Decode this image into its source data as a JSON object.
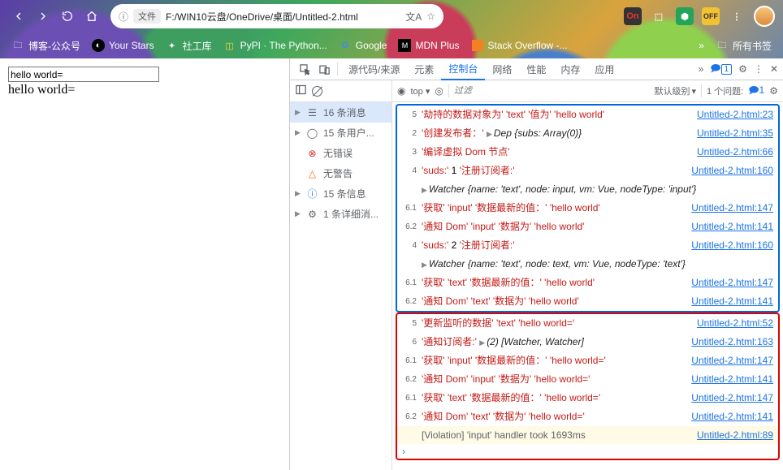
{
  "url": {
    "scheme_label": "文件",
    "path": "F:/WIN10云盘/OneDrive/桌面/Untitled-2.html"
  },
  "bookmarks": {
    "items": [
      "博客-公众号",
      "Your Stars",
      "社工库",
      "PyPI · The Python...",
      "Google",
      "MDN Plus",
      "Stack Overflow -..."
    ],
    "all": "所有书签"
  },
  "page": {
    "input_value": "hello world=",
    "text": "hello world="
  },
  "devtools": {
    "tabs": [
      "源代码/来源",
      "元素",
      "控制台",
      "网络",
      "性能",
      "内存",
      "应用"
    ],
    "active_tab": 2,
    "right_badge": "1",
    "filter_top": "top",
    "filter_placeholder": "过滤",
    "level_label": "默认级别",
    "issues_label": "1 个问题:",
    "issues_count": "1",
    "sidebar": {
      "header_count": "16 条消息",
      "items": [
        {
          "icon": "user",
          "label": "15 条用户..."
        },
        {
          "icon": "error",
          "label": "无错误"
        },
        {
          "icon": "warn",
          "label": "无警告"
        },
        {
          "icon": "info",
          "label": "15 条信息"
        },
        {
          "icon": "verbose",
          "label": "1 条详细消..."
        }
      ]
    },
    "console_groups": [
      {
        "border": "blue",
        "rows": [
          {
            "n": "5",
            "type": "msg",
            "parts": [
              [
                "str",
                "'劫持的数据对象为'"
              ],
              [
                "txt",
                " "
              ],
              [
                "str",
                "'text'"
              ],
              [
                "txt",
                " "
              ],
              [
                "str",
                "'值为'"
              ],
              [
                "txt",
                " "
              ],
              [
                "str",
                "'hello world'"
              ]
            ],
            "link": "Untitled-2.html:23"
          },
          {
            "n": "2",
            "type": "obj",
            "parts": [
              [
                "str",
                "'创建发布者：'"
              ],
              [
                "txt",
                "  "
              ],
              [
                "tri",
                ""
              ],
              [
                "obj",
                "Dep"
              ],
              [
                "txt",
                "  "
              ],
              [
                "obj",
                "{subs: Array(0)}"
              ]
            ],
            "link": "Untitled-2.html:35"
          },
          {
            "n": "3",
            "type": "msg",
            "parts": [
              [
                "str",
                "'编译虚拟 Dom 节点'"
              ]
            ],
            "link": "Untitled-2.html:66"
          },
          {
            "n": "4",
            "type": "msg",
            "parts": [
              [
                "str",
                "'suds:'"
              ],
              [
                "txt",
                " 1 "
              ],
              [
                "str",
                "'注册订阅者:'"
              ]
            ],
            "link": "Untitled-2.html:160"
          },
          {
            "n": "",
            "type": "obj",
            "parts": [
              [
                "tri",
                ""
              ],
              [
                "obj",
                "Watcher  {name: 'text', node: input, vm: Vue, nodeType: 'input'}"
              ]
            ],
            "link": ""
          },
          {
            "n": "6.1",
            "type": "msg",
            "parts": [
              [
                "str",
                "'获取'"
              ],
              [
                "txt",
                " "
              ],
              [
                "str",
                "'input'"
              ],
              [
                "txt",
                " "
              ],
              [
                "str",
                "'数据最新的值：'"
              ],
              [
                "txt",
                " "
              ],
              [
                "str",
                "'hello world'"
              ]
            ],
            "link": "Untitled-2.html:147"
          },
          {
            "n": "6.2",
            "type": "msg",
            "parts": [
              [
                "str",
                "'通知 Dom'"
              ],
              [
                "txt",
                " "
              ],
              [
                "str",
                "'input'"
              ],
              [
                "txt",
                " "
              ],
              [
                "str",
                "'数据为'"
              ],
              [
                "txt",
                " "
              ],
              [
                "str",
                "'hello world'"
              ]
            ],
            "link": "Untitled-2.html:141"
          },
          {
            "n": "4",
            "type": "msg",
            "parts": [
              [
                "str",
                "'suds:'"
              ],
              [
                "txt",
                " 2 "
              ],
              [
                "str",
                "'注册订阅者:'"
              ]
            ],
            "link": "Untitled-2.html:160"
          },
          {
            "n": "",
            "type": "obj",
            "parts": [
              [
                "tri",
                ""
              ],
              [
                "obj",
                "Watcher  {name: 'text', node: text, vm: Vue, nodeType: 'text'}"
              ]
            ],
            "link": ""
          },
          {
            "n": "6.1",
            "type": "msg",
            "parts": [
              [
                "str",
                "'获取'"
              ],
              [
                "txt",
                " "
              ],
              [
                "str",
                "'text'"
              ],
              [
                "txt",
                " "
              ],
              [
                "str",
                "'数据最新的值：'"
              ],
              [
                "txt",
                " "
              ],
              [
                "str",
                "'hello world'"
              ]
            ],
            "link": "Untitled-2.html:147"
          },
          {
            "n": "6.2",
            "type": "msg",
            "parts": [
              [
                "str",
                "'通知 Dom'"
              ],
              [
                "txt",
                " "
              ],
              [
                "str",
                "'text'"
              ],
              [
                "txt",
                " "
              ],
              [
                "str",
                "'数据为'"
              ],
              [
                "txt",
                " "
              ],
              [
                "str",
                "'hello world'"
              ]
            ],
            "link": "Untitled-2.html:141"
          }
        ]
      },
      {
        "border": "red",
        "rows": [
          {
            "n": "5",
            "type": "msg",
            "parts": [
              [
                "str",
                "'更新监听的数据'"
              ],
              [
                "txt",
                " "
              ],
              [
                "str",
                "'text'"
              ],
              [
                "txt",
                " "
              ],
              [
                "str",
                "'hello world='"
              ]
            ],
            "link": "Untitled-2.html:52"
          },
          {
            "n": "6",
            "type": "obj",
            "parts": [
              [
                "str",
                "'通知订阅者:'"
              ],
              [
                "txt",
                "  "
              ],
              [
                "tri",
                ""
              ],
              [
                "obj",
                "(2)  [Watcher, Watcher]"
              ]
            ],
            "link": "Untitled-2.html:163"
          },
          {
            "n": "6.1",
            "type": "msg",
            "parts": [
              [
                "str",
                "'获取'"
              ],
              [
                "txt",
                " "
              ],
              [
                "str",
                "'input'"
              ],
              [
                "txt",
                " "
              ],
              [
                "str",
                "'数据最新的值：'"
              ],
              [
                "txt",
                " "
              ],
              [
                "str",
                "'hello world='"
              ]
            ],
            "link": "Untitled-2.html:147"
          },
          {
            "n": "6.2",
            "type": "msg",
            "parts": [
              [
                "str",
                "'通知 Dom'"
              ],
              [
                "txt",
                " "
              ],
              [
                "str",
                "'input'"
              ],
              [
                "txt",
                " "
              ],
              [
                "str",
                "'数据为'"
              ],
              [
                "txt",
                " "
              ],
              [
                "str",
                "'hello world='"
              ]
            ],
            "link": "Untitled-2.html:141"
          },
          {
            "n": "6.1",
            "type": "msg",
            "parts": [
              [
                "str",
                "'获取'"
              ],
              [
                "txt",
                " "
              ],
              [
                "str",
                "'text'"
              ],
              [
                "txt",
                " "
              ],
              [
                "str",
                "'数据最新的值：'"
              ],
              [
                "txt",
                " "
              ],
              [
                "str",
                "'hello world='"
              ]
            ],
            "link": "Untitled-2.html:147"
          },
          {
            "n": "6.2",
            "type": "msg",
            "parts": [
              [
                "str",
                "'通知 Dom'"
              ],
              [
                "txt",
                " "
              ],
              [
                "str",
                "'text'"
              ],
              [
                "txt",
                " "
              ],
              [
                "str",
                "'数据为'"
              ],
              [
                "txt",
                " "
              ],
              [
                "str",
                "'hello world='"
              ]
            ],
            "link": "Untitled-2.html:141"
          },
          {
            "n": "",
            "type": "viol",
            "parts": [
              [
                "txt",
                "[Violation] 'input' handler took 1693ms"
              ]
            ],
            "link": "Untitled-2.html:89"
          }
        ]
      }
    ]
  }
}
